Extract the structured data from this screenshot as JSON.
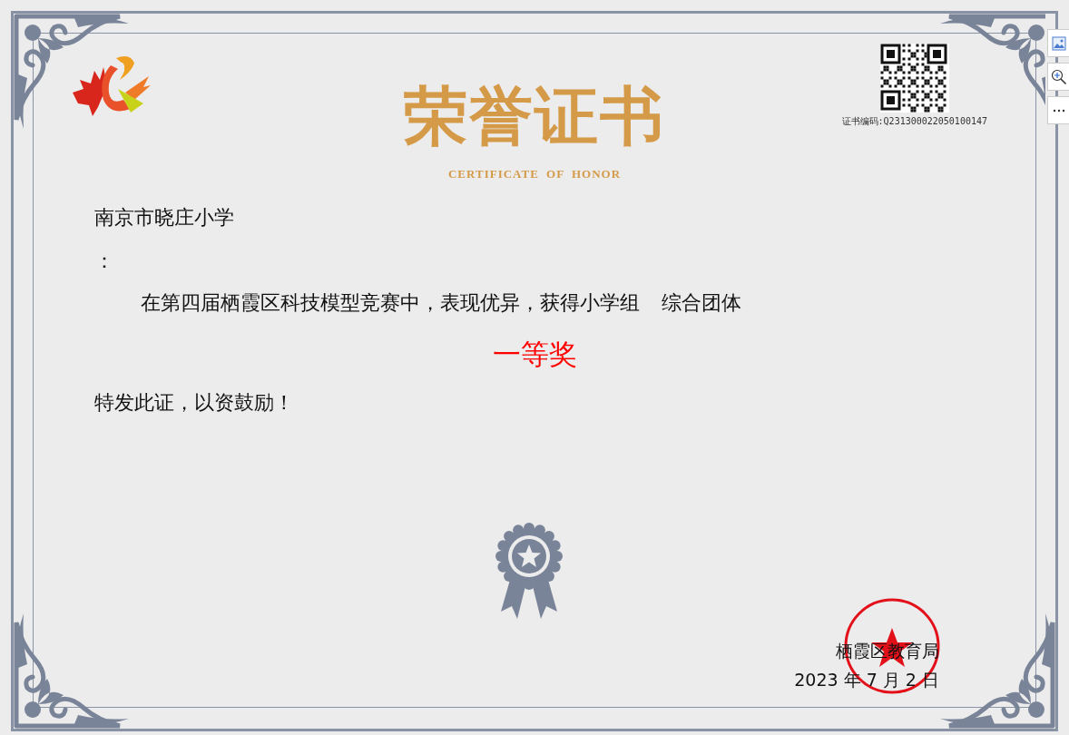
{
  "certificate": {
    "title": "荣誉证书",
    "subtitle": "CERTIFICATE OF HONOR",
    "certificate_number": "证书编码:Q231300022050100147",
    "recipient": "南京市晓庄小学",
    "colon": "：",
    "body_text": "在第四届栖霞区科技模型竞赛中，表现优异，获得小学组",
    "category": "综合团体",
    "award": "一等奖",
    "closing": "特发此证，以资鼓励！",
    "issuer": "栖霞区教育局",
    "date": "2023 年 7 月 2 日"
  }
}
